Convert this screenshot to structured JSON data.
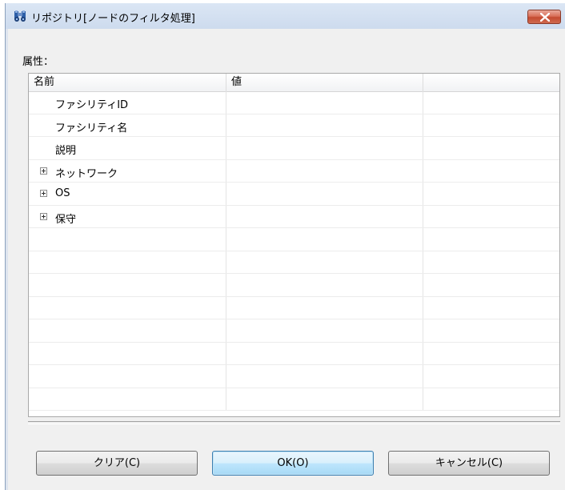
{
  "window": {
    "title": "リポジトリ[ノードのフィルタ処理]"
  },
  "attributes": {
    "label": "属性："
  },
  "tree": {
    "columns": [
      "名前",
      "値",
      ""
    ],
    "rows": [
      {
        "name": "ファシリティID",
        "value": "",
        "expandable": false
      },
      {
        "name": "ファシリティ名",
        "value": "",
        "expandable": false
      },
      {
        "name": "説明",
        "value": "",
        "expandable": false
      },
      {
        "name": "ネットワーク",
        "value": "",
        "expandable": true
      },
      {
        "name": "OS",
        "value": "",
        "expandable": true
      },
      {
        "name": "保守",
        "value": "",
        "expandable": true
      }
    ],
    "empty_row_count": 8
  },
  "buttons": {
    "clear": "クリア(C)",
    "ok": "OK(O)",
    "cancel": "キャンセル(C)"
  }
}
